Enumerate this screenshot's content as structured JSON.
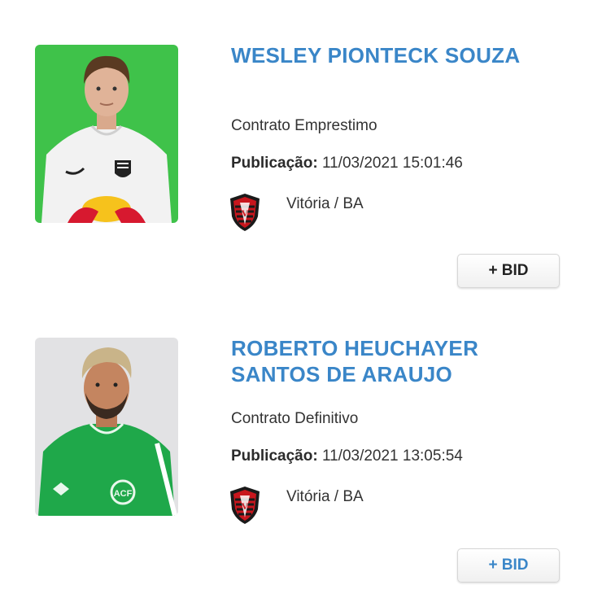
{
  "players": [
    {
      "name": "WESLEY PIONTECK SOUZA",
      "contract": "Contrato Emprestimo",
      "publication_label": "Publicação:",
      "publication_datetime": "11/03/2021 15:01:46",
      "club": "Vitória / BA",
      "bid_button": "+ BID",
      "photo_background": "#3fc24a",
      "shirt_color": "#f2f2f2"
    },
    {
      "name": "ROBERTO HEUCHAYER SANTOS DE ARAUJO",
      "contract": "Contrato Definitivo",
      "publication_label": "Publicação:",
      "publication_datetime": "11/03/2021 13:05:54",
      "club": "Vitória / BA",
      "bid_button": "+ BID",
      "photo_background": "#e2e2e4",
      "shirt_color": "#1fa84a"
    }
  ],
  "colors": {
    "name_blue": "#3a86c8",
    "crest_red": "#c8161d",
    "crest_black": "#1a1a1a"
  }
}
